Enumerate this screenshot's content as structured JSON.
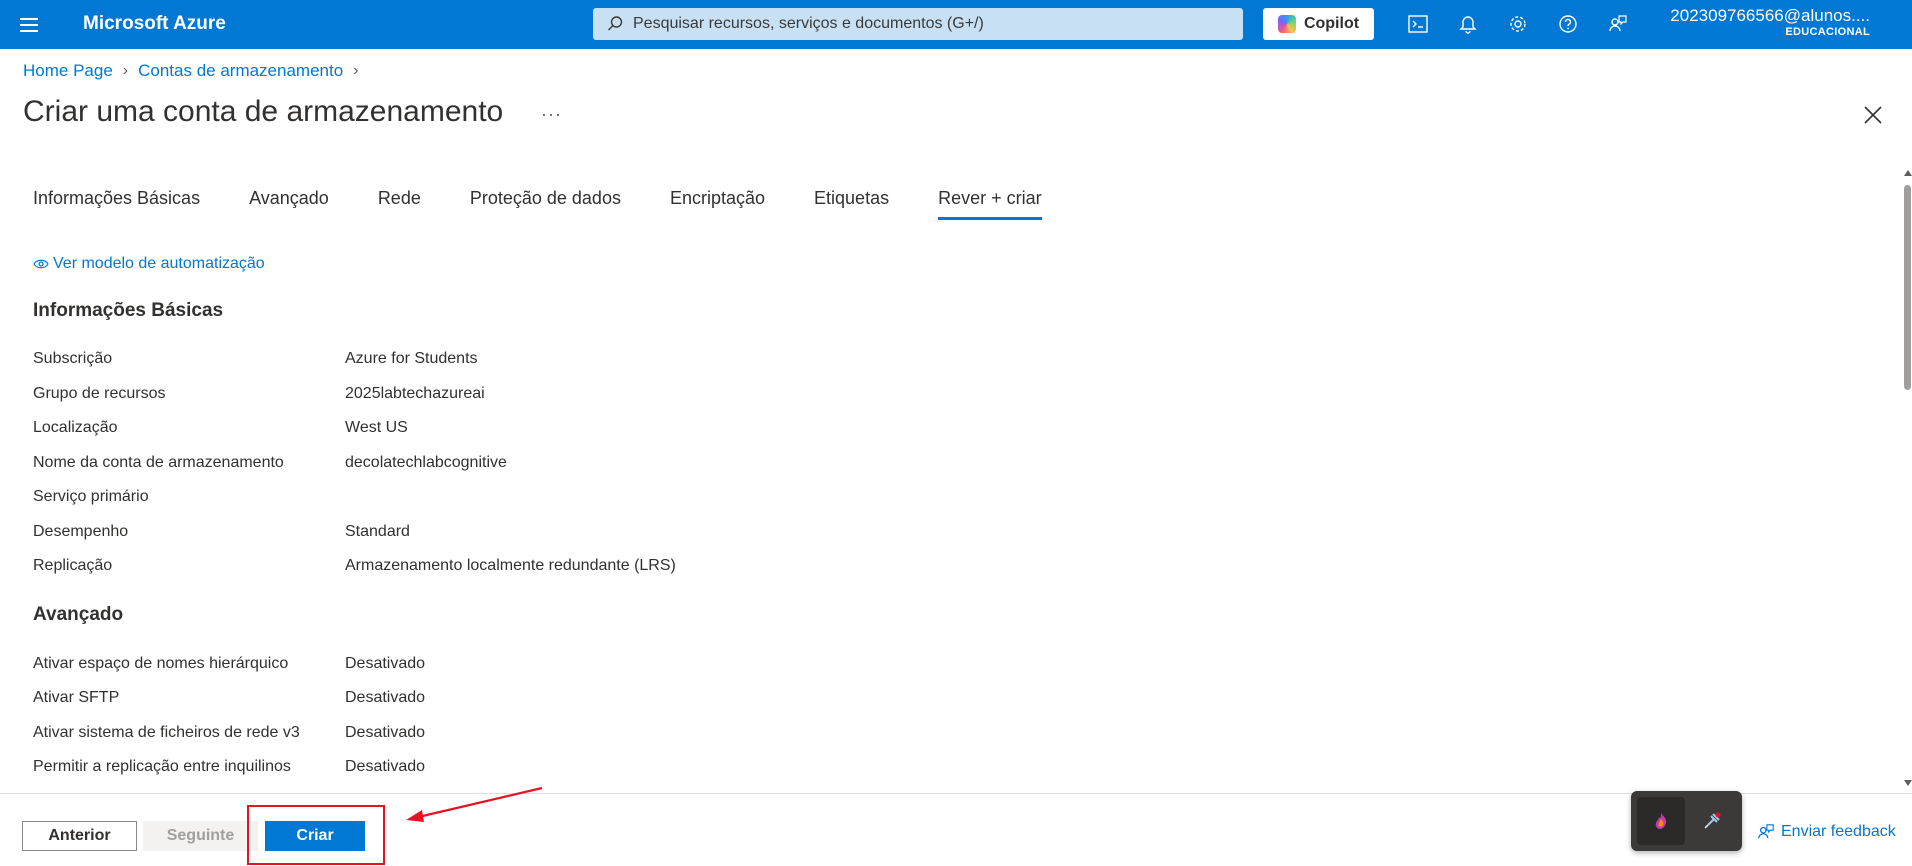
{
  "topbar": {
    "brand": "Microsoft Azure",
    "search_placeholder": "Pesquisar recursos, serviços e documentos (G+/)",
    "copilot_label": "Copilot",
    "account_email": "202309766566@alunos....",
    "account_tier": "EDUCACIONAL"
  },
  "breadcrumb": {
    "items": [
      "Home Page",
      "Contas de armazenamento"
    ]
  },
  "page": {
    "title": "Criar uma conta de armazenamento",
    "more": "···"
  },
  "tabs": [
    {
      "label": "Informações Básicas"
    },
    {
      "label": "Avançado"
    },
    {
      "label": "Rede"
    },
    {
      "label": "Proteção de dados"
    },
    {
      "label": "Encriptação"
    },
    {
      "label": "Etiquetas"
    },
    {
      "label": "Rever + criar",
      "active": true
    }
  ],
  "automation_link": "Ver modelo de automatização",
  "sections": {
    "basics": {
      "title": "Informações Básicas",
      "rows": [
        {
          "k": "Subscrição",
          "v": "Azure for Students"
        },
        {
          "k": "Grupo de recursos",
          "v": "2025labtechazureai"
        },
        {
          "k": "Localização",
          "v": "West US"
        },
        {
          "k": "Nome da conta de armazenamento",
          "v": "decolatechlabcognitive"
        },
        {
          "k": "Serviço primário",
          "v": ""
        },
        {
          "k": "Desempenho",
          "v": "Standard"
        },
        {
          "k": "Replicação",
          "v": "Armazenamento localmente redundante (LRS)"
        }
      ]
    },
    "advanced": {
      "title": "Avançado",
      "rows": [
        {
          "k": "Ativar espaço de nomes hierárquico",
          "v": "Desativado"
        },
        {
          "k": "Ativar SFTP",
          "v": "Desativado"
        },
        {
          "k": "Ativar sistema de ficheiros de rede v3",
          "v": "Desativado"
        },
        {
          "k": "Permitir a replicação entre inquilinos",
          "v": "Desativado"
        }
      ]
    }
  },
  "footer": {
    "prev_label": "Anterior",
    "next_label": "Seguinte",
    "create_label": "Criar",
    "feedback_label": "Enviar feedback"
  },
  "colors": {
    "accent": "#0078d4",
    "annotation": "#e81123"
  }
}
